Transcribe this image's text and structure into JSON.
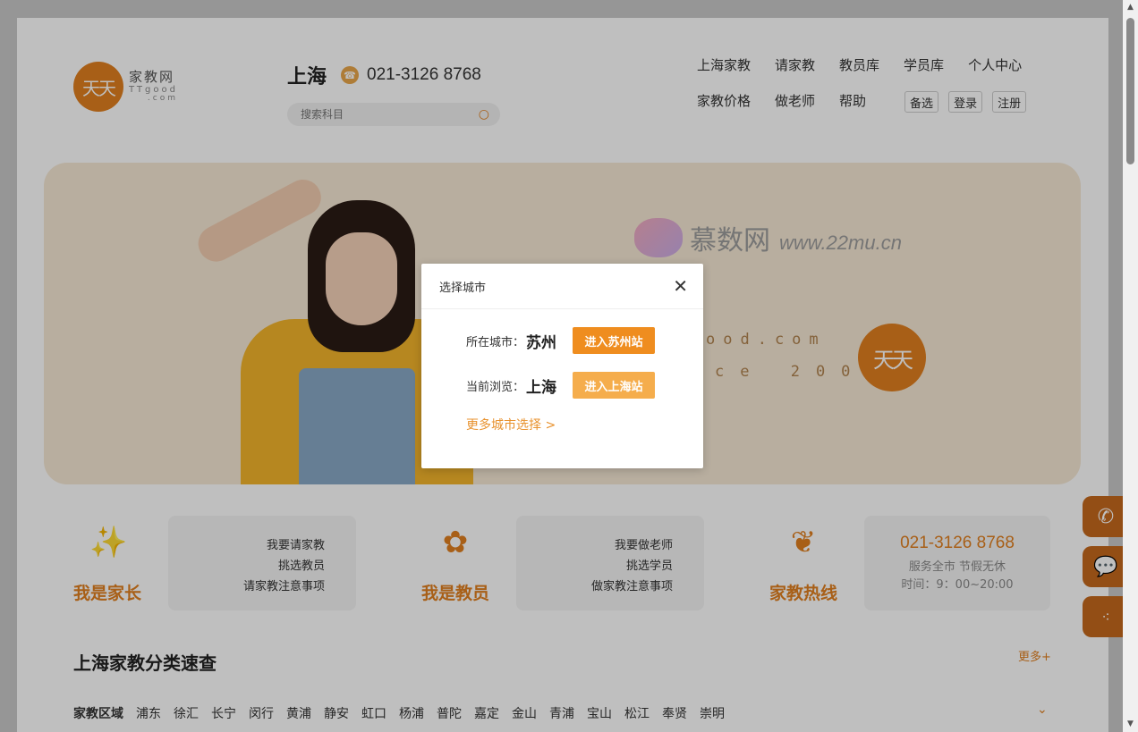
{
  "header": {
    "logo_cn": "家教网",
    "logo_en": "TTgood",
    "logo_com": ".com",
    "logo_mark": "天天",
    "city": "上海",
    "phone": "021-3126 8768",
    "search_placeholder": "搜索科目"
  },
  "nav": {
    "row1": [
      "上海家教",
      "请家教",
      "教员库",
      "学员库",
      "个人中心"
    ],
    "row2": [
      "家教价格",
      "做老师",
      "帮助"
    ],
    "buttons": [
      "备选",
      "登录",
      "注册"
    ]
  },
  "banner": {
    "site": "ood.com",
    "since": "ce 2003",
    "seal": "天天",
    "watermark_cn": "慕数网",
    "watermark_url": "www.22mu.cn"
  },
  "roles": [
    {
      "title": "我是家长",
      "links": [
        "我要请家教",
        "挑选教员",
        "请家教注意事项"
      ]
    },
    {
      "title": "我是教员",
      "links": [
        "我要做老师",
        "挑选学员",
        "做家教注意事项"
      ]
    },
    {
      "title": "家教热线",
      "phone": "021-3126 8768",
      "sub1": "服务全市 节假无休",
      "sub2": "时间：9：00~20:00"
    }
  ],
  "category": {
    "title": "上海家教分类速查",
    "more": "更多+",
    "label": "家教区域",
    "districts": [
      "浦东",
      "徐汇",
      "长宁",
      "闵行",
      "黄浦",
      "静安",
      "虹口",
      "杨浦",
      "普陀",
      "嘉定",
      "金山",
      "青浦",
      "宝山",
      "松江",
      "奉贤",
      "崇明"
    ]
  },
  "modal": {
    "title": "选择城市",
    "located_label": "所在城市：",
    "located_city": "苏州",
    "located_btn": "进入苏州站",
    "browsing_label": "当前浏览：",
    "browsing_city": "上海",
    "browsing_btn": "进入上海站",
    "more": "更多城市选择 >"
  },
  "colors": {
    "accent": "#e07f1f",
    "button_primary": "#ef8d1f",
    "button_secondary": "#f5ad4c"
  }
}
